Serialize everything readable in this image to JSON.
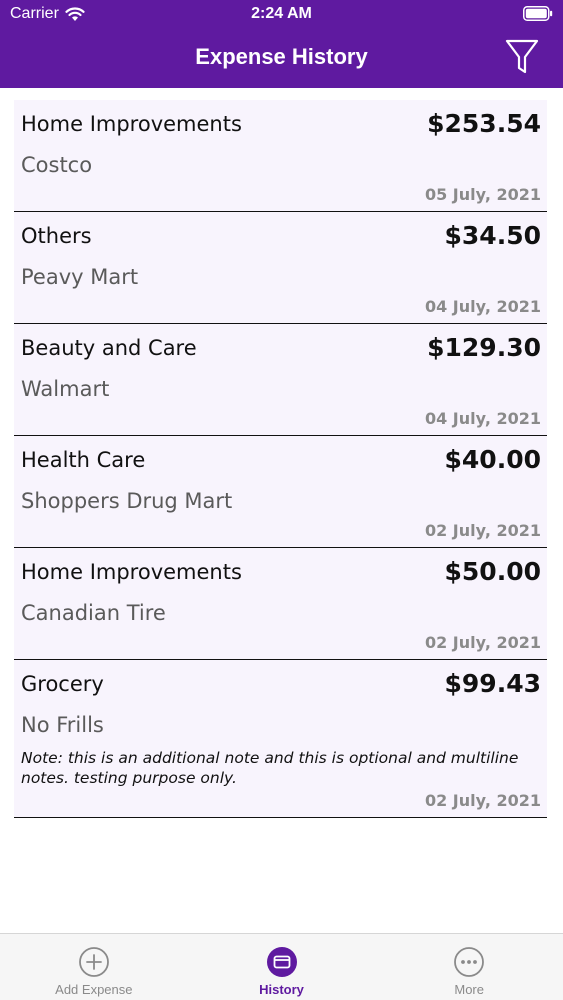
{
  "status_bar": {
    "carrier": "Carrier",
    "time": "2:24 AM"
  },
  "header": {
    "title": "Expense History",
    "filter_icon": "filter-funnel-icon"
  },
  "colors": {
    "brand": "#5f1aa0",
    "card_bg": "#f8f4fd",
    "muted": "#8a8a8a"
  },
  "expenses": [
    {
      "category": "Home Improvements",
      "amount": "$253.54",
      "store": "Costco",
      "date": "05 July, 2021"
    },
    {
      "category": "Others",
      "amount": "$34.50",
      "store": "Peavy Mart",
      "date": "04 July, 2021"
    },
    {
      "category": "Beauty and Care",
      "amount": "$129.30",
      "store": "Walmart",
      "date": "04 July, 2021"
    },
    {
      "category": "Health Care",
      "amount": "$40.00",
      "store": "Shoppers Drug Mart",
      "date": "02 July, 2021"
    },
    {
      "category": "Home Improvements",
      "amount": "$50.00",
      "store": "Canadian Tire",
      "date": "02 July, 2021"
    },
    {
      "category": "Grocery",
      "amount": "$99.43",
      "store": "No Frills",
      "note": "Note: this is an additional note and this is optional and multiline notes. testing purpose only.",
      "date": "02 July, 2021"
    }
  ],
  "tabbar": {
    "tabs": [
      {
        "label": "Add Expense",
        "icon": "plus-circle-icon",
        "active": false
      },
      {
        "label": "History",
        "icon": "history-folder-icon",
        "active": true
      },
      {
        "label": "More",
        "icon": "more-ellipsis-icon",
        "active": false
      }
    ]
  }
}
